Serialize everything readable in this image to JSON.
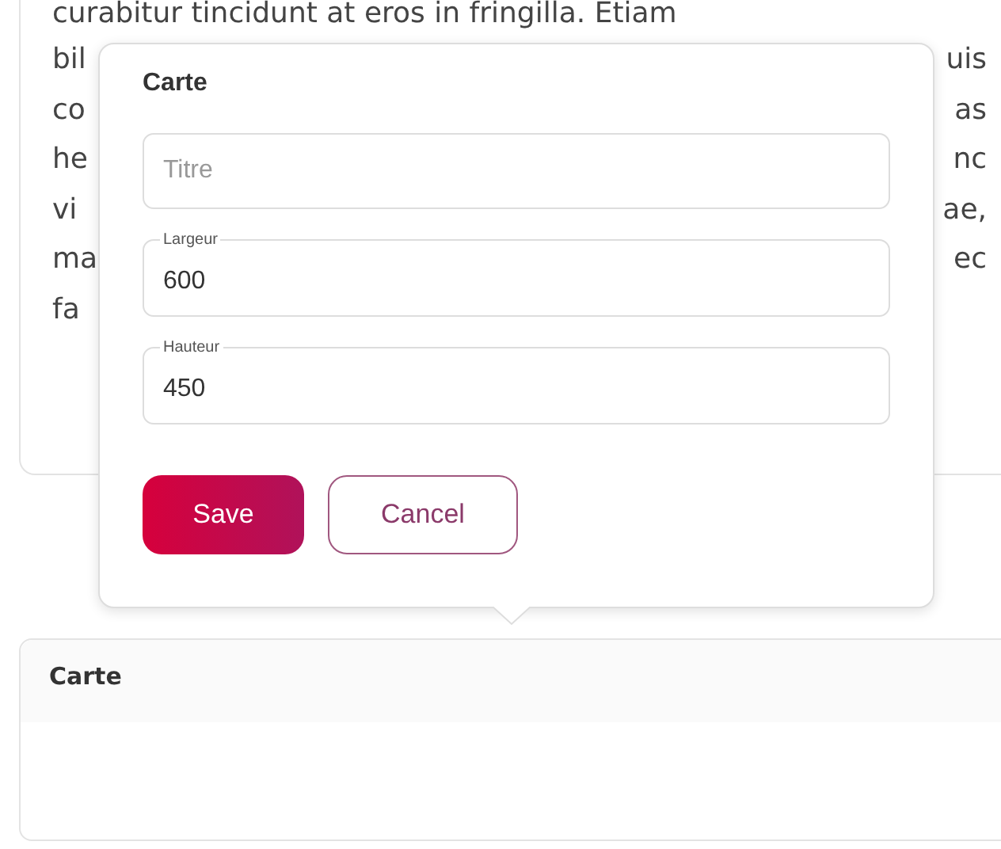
{
  "background_card": {
    "first_line": "curabitur tincidunt at eros in fringilla. Etiam",
    "lines": [
      {
        "left": "bil",
        "right": "uis"
      },
      {
        "left": "co",
        "right": "as"
      },
      {
        "left": "he",
        "right": "nc"
      },
      {
        "left": "vi",
        "right": "ae,"
      },
      {
        "left": "ma",
        "right": "ec"
      },
      {
        "left": "fa"
      }
    ]
  },
  "popover": {
    "title": "Carte",
    "fields": [
      {
        "placeholder": "Titre"
      },
      {
        "label": "Largeur",
        "value": "600"
      },
      {
        "label": "Hauteur",
        "value": "450"
      }
    ],
    "buttons": [
      {
        "label": "Save",
        "kind": "primary"
      },
      {
        "label": "Cancel",
        "kind": "secondary"
      }
    ]
  },
  "panel": {
    "title": "Carte"
  }
}
